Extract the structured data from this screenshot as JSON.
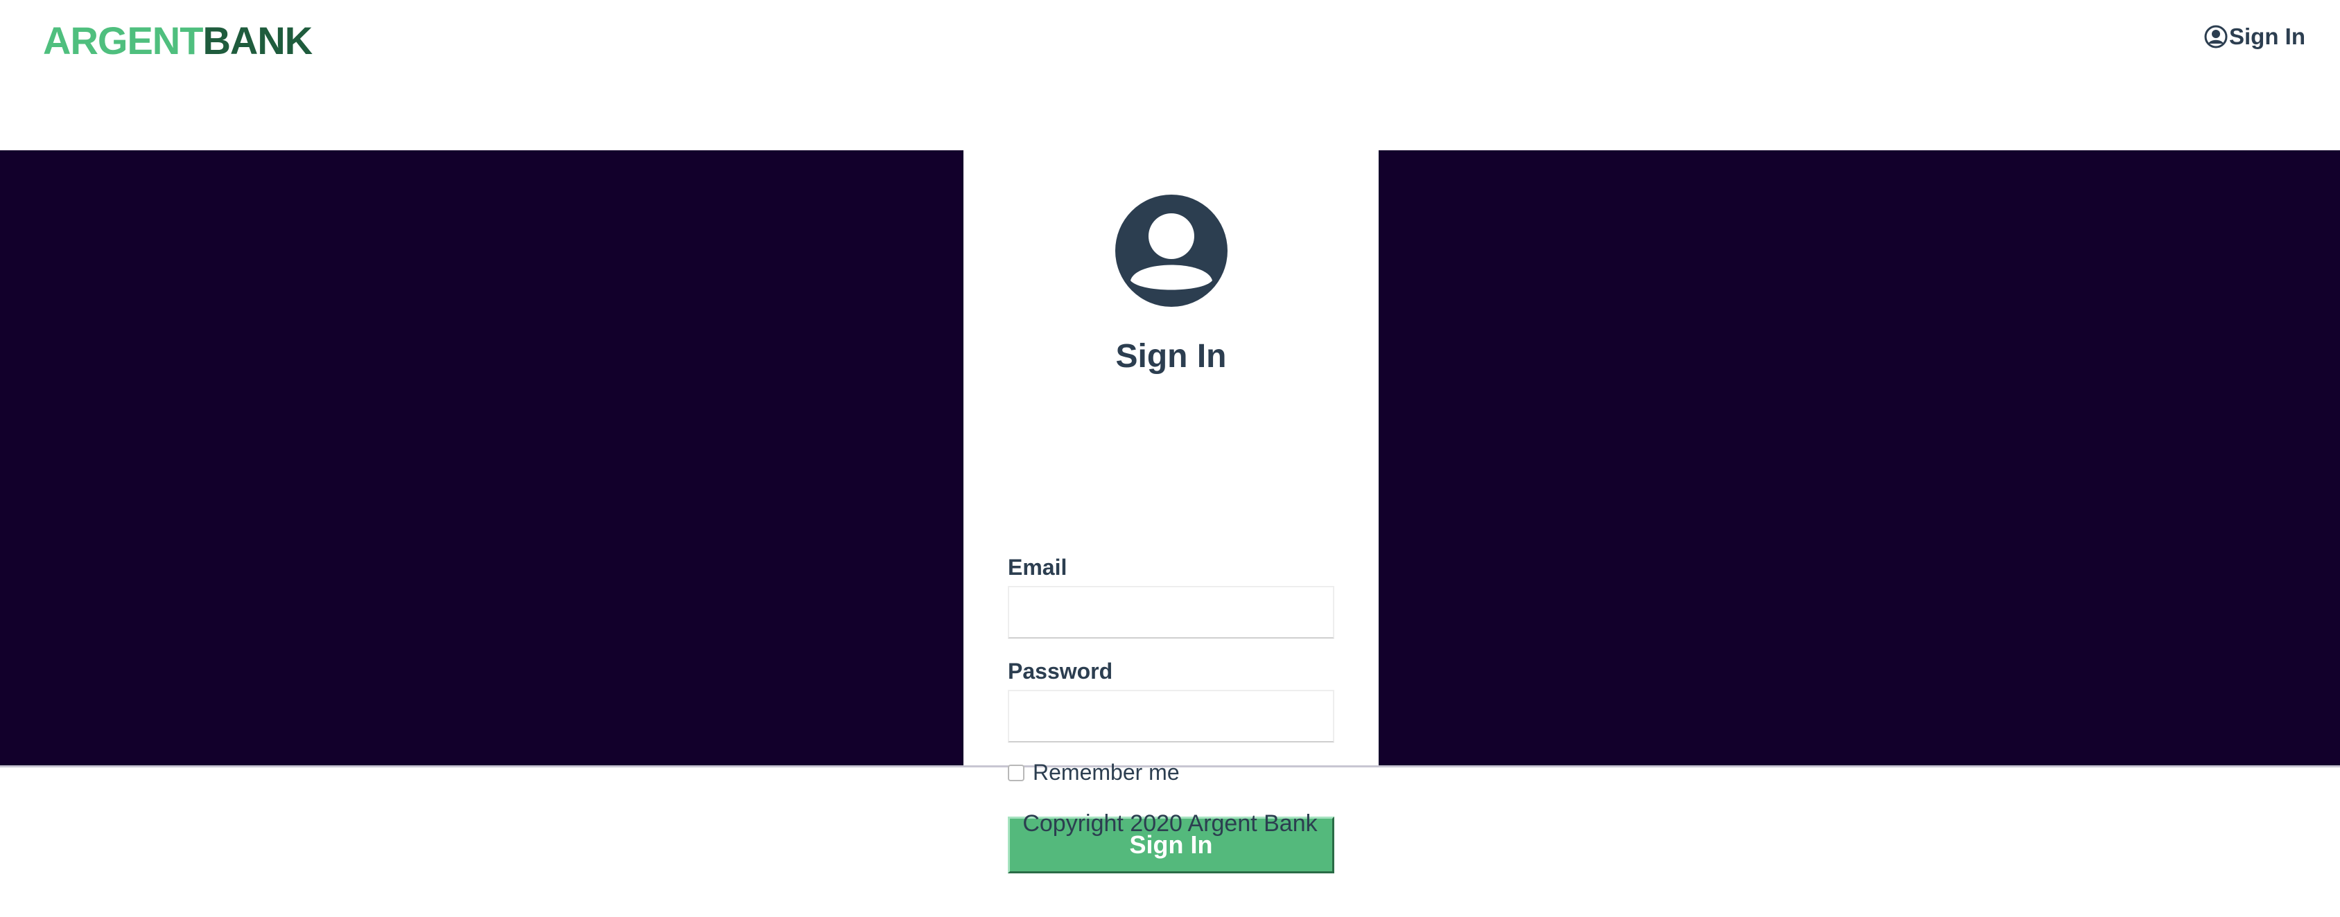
{
  "header": {
    "logo_part1": "ARGENT",
    "logo_part2": "BANK",
    "nav_signin_label": "Sign In"
  },
  "login": {
    "title": "Sign In",
    "email_label": "Email",
    "email_value": "",
    "password_label": "Password",
    "password_value": "",
    "remember_label": "Remember me",
    "remember_checked": false,
    "submit_label": "Sign In"
  },
  "footer": {
    "copyright": "Copyright 2020 Argent Bank"
  },
  "colors": {
    "brand_green": "#4fbf7e",
    "brand_dark_green": "#1f5c3d",
    "hero_background": "#12002b",
    "button_green": "#54b97c",
    "text_dark": "#2c3e50"
  },
  "icons": {
    "nav_user": "user-circle-icon",
    "avatar": "user-circle-icon"
  }
}
